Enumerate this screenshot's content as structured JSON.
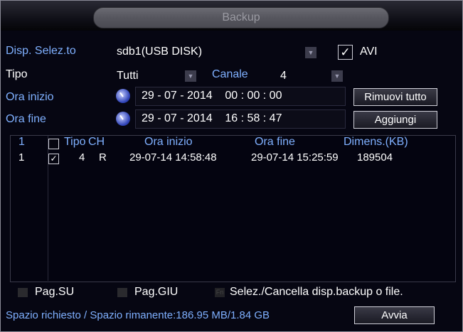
{
  "window": {
    "title": "Backup"
  },
  "device": {
    "label": "Disp. Selez.to",
    "value": "sdb1(USB DISK)",
    "avi_label": "AVI",
    "avi_checked": true
  },
  "type": {
    "label": "Tipo",
    "value": "Tutti"
  },
  "channel": {
    "label": "Canale",
    "value": "4"
  },
  "start_time": {
    "label": "Ora inizio",
    "value": "29 - 07 - 2014    00 : 00 : 00"
  },
  "end_time": {
    "label": "Ora fine",
    "value": "29 - 07 - 2014    16 : 58 : 47"
  },
  "buttons": {
    "remove_all": "Rimuovi tutto",
    "add": "Aggiungi",
    "start": "Avvia"
  },
  "table": {
    "headers": {
      "index": "1",
      "type": "Tipo",
      "ch": "CH",
      "start": "Ora inizio",
      "end": "Ora fine",
      "size": "Dimens.(KB)"
    },
    "rows": [
      {
        "index": "1",
        "checked": true,
        "ch": "4",
        "type": "R",
        "start": "29-07-14 14:58:48",
        "end": "29-07-14 15:25:59",
        "size": "189504"
      }
    ]
  },
  "nav": {
    "page_up": "Pag.SU",
    "page_down": "Pag.GIU",
    "fn_hint": "Selez./Cancella disp.backup o file."
  },
  "footer": {
    "space_text": "Spazio richiesto / Spazio rimanente:186.95 MB/1.84 GB"
  },
  "colors": {
    "accent_blue": "#7fb0ff",
    "background": "#060612",
    "text": "#ffffff"
  }
}
